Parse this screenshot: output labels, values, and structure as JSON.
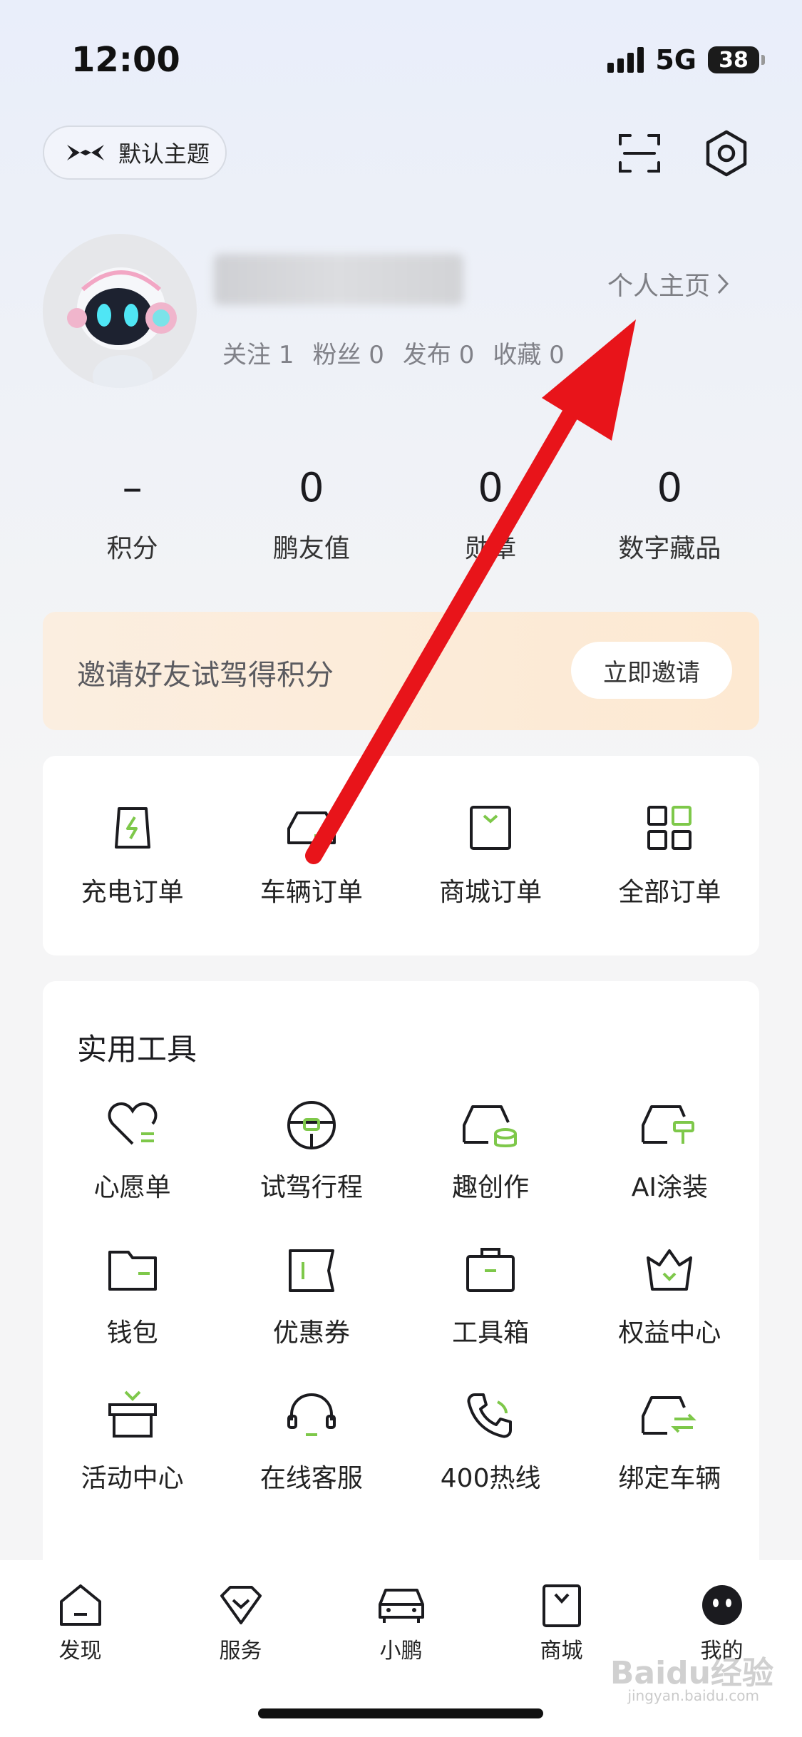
{
  "status_bar": {
    "time": "12:00",
    "network": "5G",
    "battery": "38"
  },
  "header": {
    "theme_label": "默认主题",
    "scan_icon": "scan-icon",
    "settings_icon": "hexagon-gear-icon"
  },
  "profile": {
    "homepage_label": "个人主页",
    "stats": [
      {
        "label": "关注",
        "value": "1"
      },
      {
        "label": "粉丝",
        "value": "0"
      },
      {
        "label": "发布",
        "value": "0"
      },
      {
        "label": "收藏",
        "value": "0"
      }
    ]
  },
  "metrics": [
    {
      "value": "–",
      "label": "积分"
    },
    {
      "value": "0",
      "label": "鹏友值"
    },
    {
      "value": "0",
      "label": "勋章"
    },
    {
      "value": "0",
      "label": "数字藏品"
    }
  ],
  "invite": {
    "text": "邀请好友试驾得积分",
    "button": "立即邀请"
  },
  "orders": [
    {
      "label": "充电订单",
      "icon": "charging-order-icon"
    },
    {
      "label": "车辆订单",
      "icon": "car-order-icon"
    },
    {
      "label": "商城订单",
      "icon": "mall-order-icon"
    },
    {
      "label": "全部订单",
      "icon": "all-orders-icon"
    }
  ],
  "tools": {
    "title": "实用工具",
    "items": [
      {
        "label": "心愿单",
        "icon": "heart-list-icon"
      },
      {
        "label": "试驾行程",
        "icon": "steering-wheel-icon"
      },
      {
        "label": "趣创作",
        "icon": "car-coins-icon"
      },
      {
        "label": "AI涂装",
        "icon": "car-paint-icon"
      },
      {
        "label": "钱包",
        "icon": "wallet-icon"
      },
      {
        "label": "优惠券",
        "icon": "coupon-icon"
      },
      {
        "label": "工具箱",
        "icon": "toolbox-icon"
      },
      {
        "label": "权益中心",
        "icon": "crown-icon"
      },
      {
        "label": "活动中心",
        "icon": "gift-box-icon"
      },
      {
        "label": "在线客服",
        "icon": "headset-icon"
      },
      {
        "label": "400热线",
        "icon": "phone-icon"
      },
      {
        "label": "绑定车辆",
        "icon": "car-bind-icon"
      }
    ]
  },
  "bottom_nav": [
    {
      "label": "发现",
      "icon": "home-icon"
    },
    {
      "label": "服务",
      "icon": "service-icon"
    },
    {
      "label": "小鹏",
      "icon": "car-icon"
    },
    {
      "label": "商城",
      "icon": "shopping-bag-icon"
    },
    {
      "label": "我的",
      "icon": "avatar-face-icon"
    }
  ],
  "colors": {
    "accent_green": "#7ec84a",
    "annotation_red": "#e8141a",
    "invite_bg": "#fdebd6"
  },
  "watermark": {
    "text": "Baidu经验",
    "sub": "jingyan.baidu.com"
  }
}
